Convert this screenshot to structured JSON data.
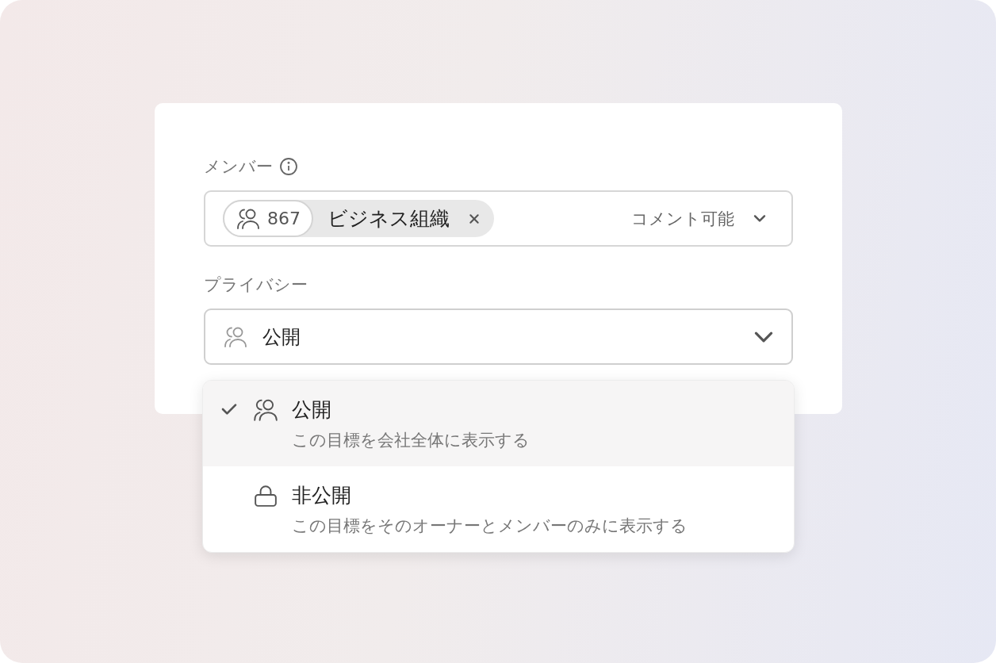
{
  "members": {
    "label": "メンバー",
    "tag": {
      "count": "867",
      "name": "ビジネス組織"
    },
    "permission": "コメント可能"
  },
  "privacy": {
    "label": "プライバシー",
    "kind": "people",
    "value": "公開",
    "expanded": true,
    "options": [
      {
        "kind": "people",
        "title": "公開",
        "description": "この目標を会社全体に表示する",
        "selected": true
      },
      {
        "kind": "lock",
        "title": "非公開",
        "description": "この目標をそのオーナーとメンバーのみに表示する",
        "selected": false
      }
    ]
  }
}
